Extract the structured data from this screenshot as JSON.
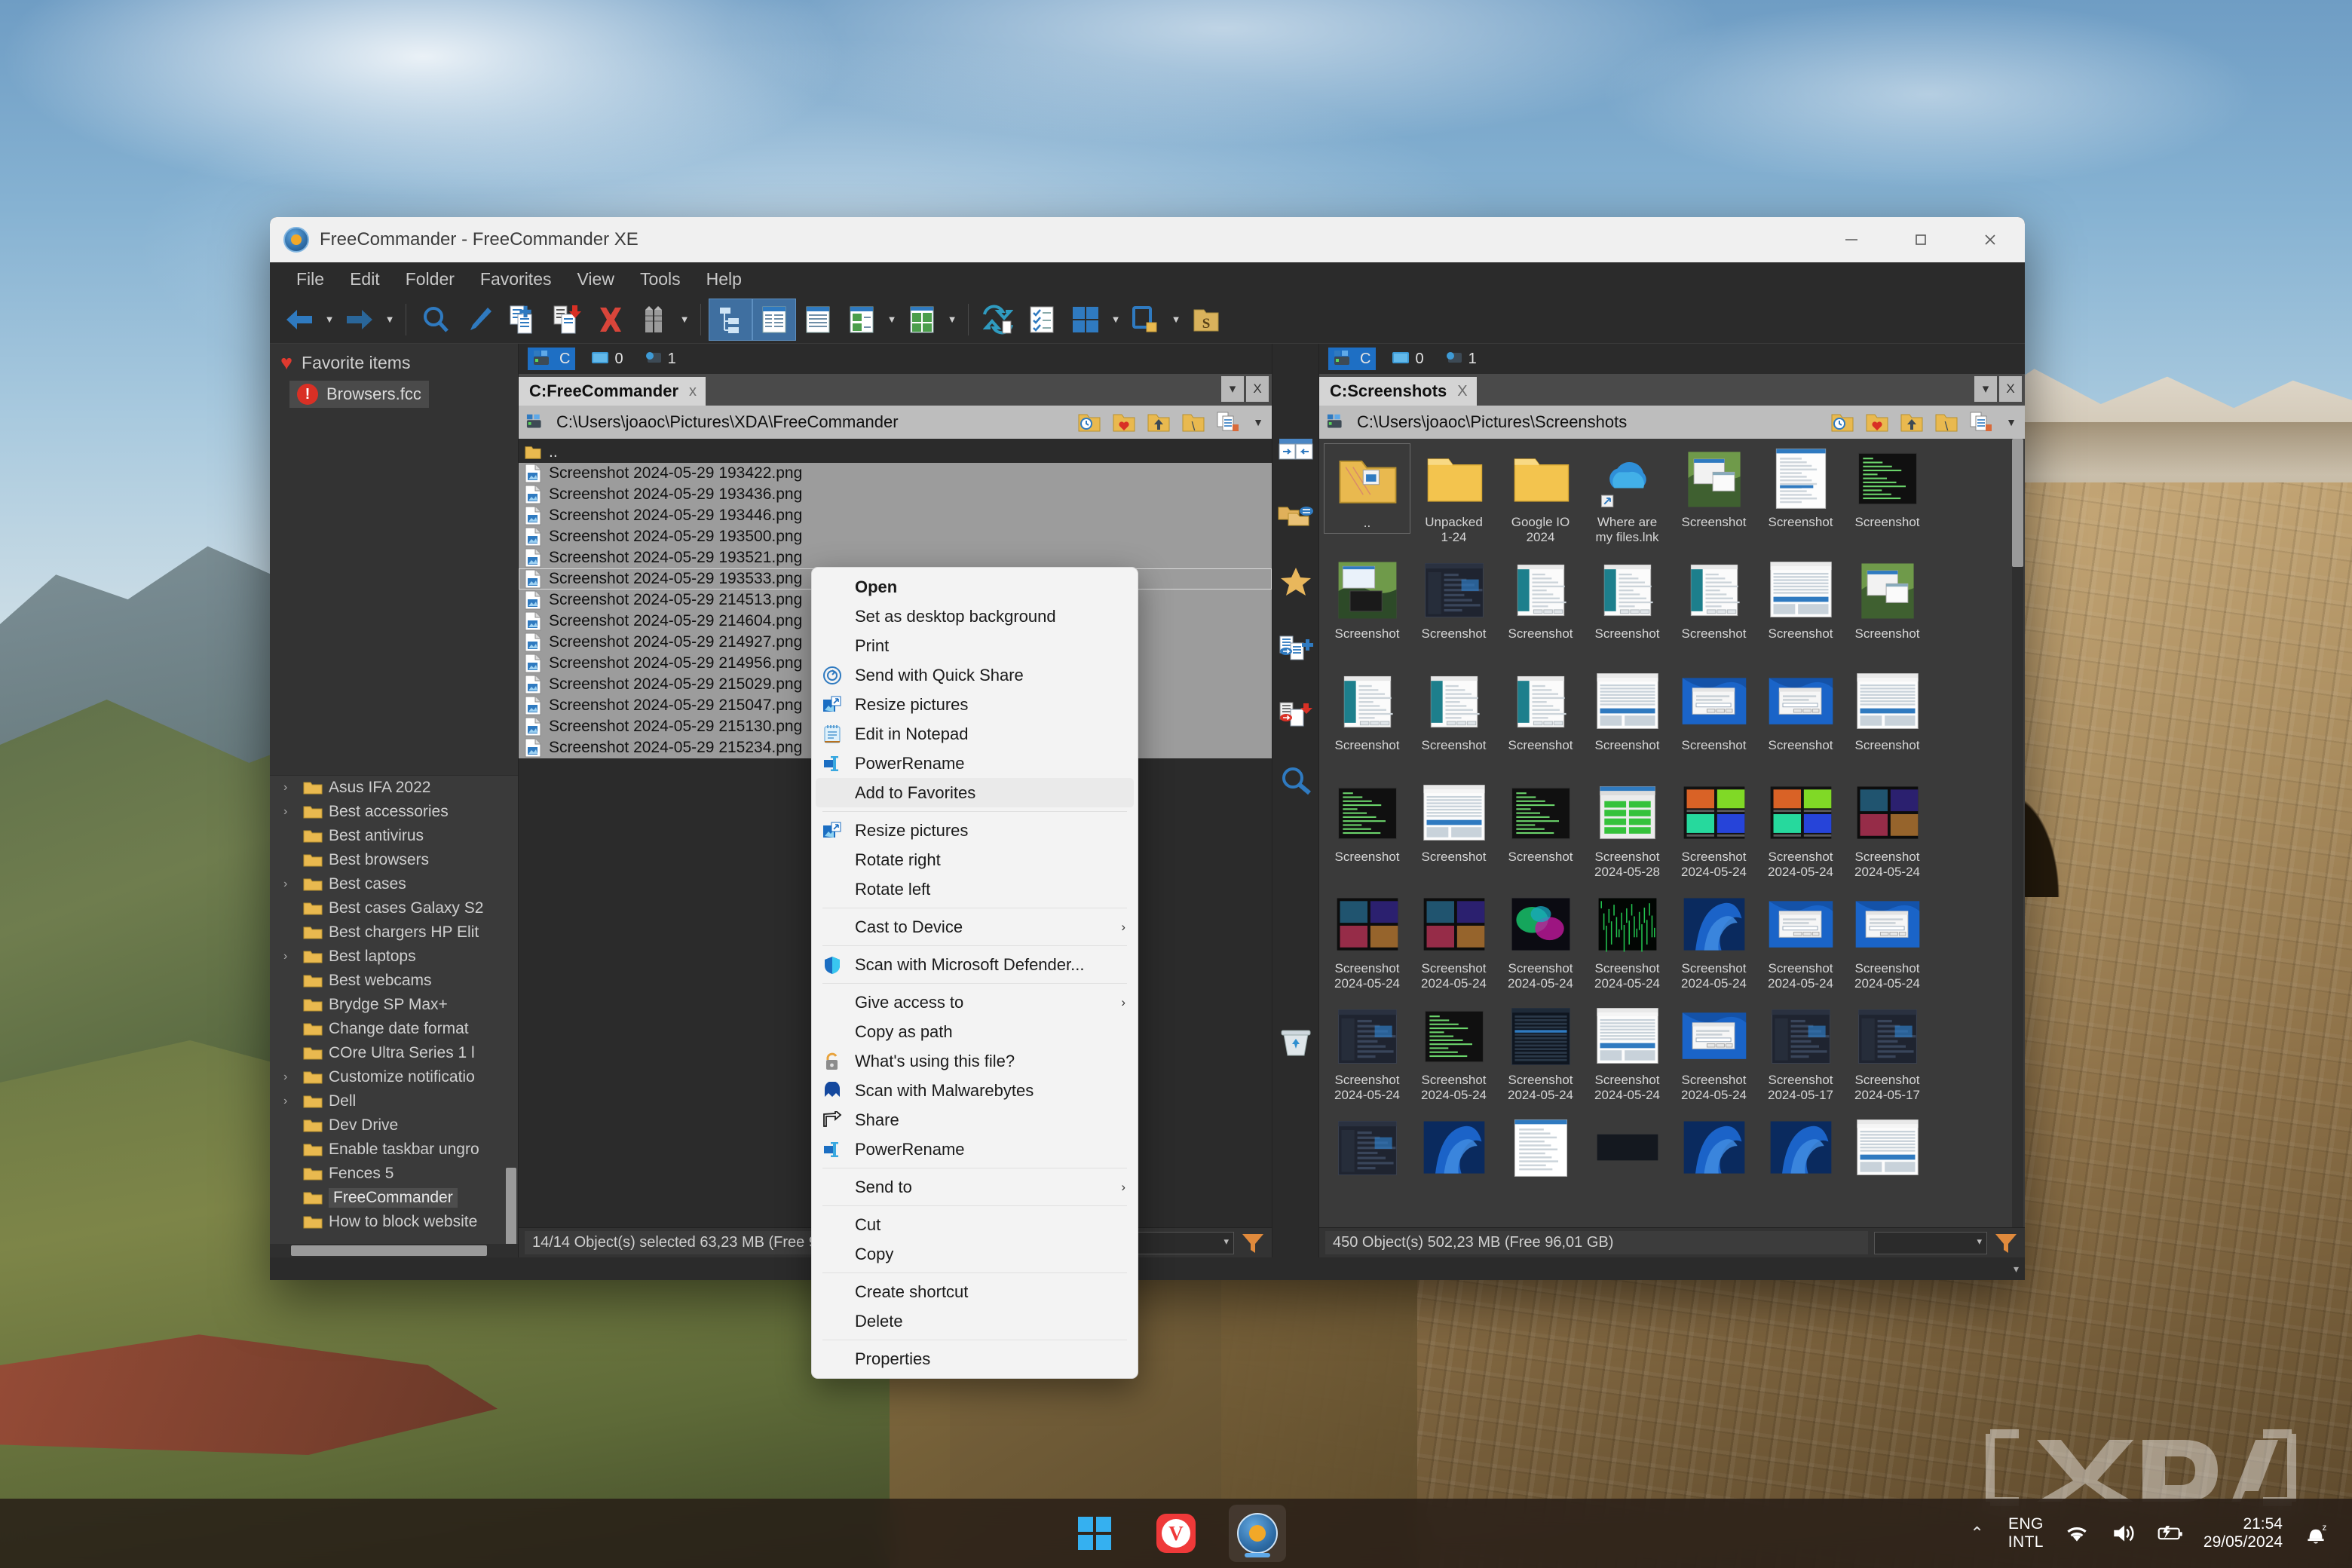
{
  "window": {
    "title": "FreeCommander - FreeCommander XE",
    "app_icon": "freecommander-compass-icon",
    "controls": {
      "minimize": "minimize-icon",
      "maximize": "maximize-icon",
      "close": "close-icon"
    }
  },
  "menubar": [
    "File",
    "Edit",
    "Folder",
    "Favorites",
    "View",
    "Tools",
    "Help"
  ],
  "toolbar": {
    "groups": [
      [
        "back-arrow-icon",
        "back-dropdown-caret",
        "forward-arrow-icon",
        "forward-dropdown-caret"
      ],
      [
        "search-icon",
        "edit-pencil-icon",
        "copy-file-icon",
        "move-file-icon",
        "delete-x-icon",
        "pack-icon",
        "pack-dropdown-caret"
      ],
      [
        "tree-view-icon",
        "details-view-icon",
        "list-view-icon",
        "thumbnail-view-icon",
        "thumbnail-dropdown-caret",
        "large-thumbnail-view-icon",
        "large-thumbnail-dropdown-caret"
      ],
      [
        "sync-folders-icon",
        "checklist-icon",
        "split-view-icon",
        "split-view-dropdown-caret",
        "screen-icon",
        "screen-dropdown-caret",
        "folder-s-icon"
      ]
    ]
  },
  "favorites_pane": {
    "header_label": "Favorite items",
    "header_icon": "heart-icon",
    "items": [
      {
        "label": "Browsers.fcc",
        "icon": "warning-circle-icon",
        "selected": true
      }
    ]
  },
  "folder_tree": {
    "items": [
      {
        "label": "Asus IFA 2022",
        "expandable": true,
        "selected": false
      },
      {
        "label": "Best accessories",
        "expandable": true,
        "selected": false
      },
      {
        "label": "Best antivirus",
        "expandable": false,
        "selected": false
      },
      {
        "label": "Best browsers",
        "expandable": false,
        "selected": false
      },
      {
        "label": "Best cases",
        "expandable": true,
        "selected": false
      },
      {
        "label": "Best cases Galaxy S2",
        "expandable": false,
        "selected": false
      },
      {
        "label": "Best chargers HP Elit",
        "expandable": false,
        "selected": false
      },
      {
        "label": "Best laptops",
        "expandable": true,
        "selected": false
      },
      {
        "label": "Best webcams",
        "expandable": false,
        "selected": false
      },
      {
        "label": "Brydge SP Max+",
        "expandable": false,
        "selected": false
      },
      {
        "label": "Change date format",
        "expandable": false,
        "selected": false
      },
      {
        "label": "COre Ultra Series 1 l",
        "expandable": false,
        "selected": false
      },
      {
        "label": "Customize notificatio",
        "expandable": true,
        "selected": false
      },
      {
        "label": "Dell",
        "expandable": true,
        "selected": false
      },
      {
        "label": "Dev Drive",
        "expandable": false,
        "selected": false
      },
      {
        "label": "Enable taskbar ungro",
        "expandable": false,
        "selected": false
      },
      {
        "label": "Fences 5",
        "expandable": false,
        "selected": false
      },
      {
        "label": "FreeCommander",
        "expandable": false,
        "selected": true
      },
      {
        "label": "How to block website",
        "expandable": false,
        "selected": false
      }
    ]
  },
  "left_panel": {
    "drives": [
      {
        "label": "C",
        "icon": "drive-c-icon",
        "active": true
      },
      {
        "label": "0",
        "icon": "network-drive-icon",
        "active": false
      },
      {
        "label": "1",
        "icon": "remote-drive-icon",
        "active": false
      }
    ],
    "tab": {
      "label": "C:FreeCommander",
      "close": "x"
    },
    "tab_controls": {
      "dropdown": "▾",
      "close": "X"
    },
    "path": "C:\\Users\\joaoc\\Pictures\\XDA\\FreeCommander",
    "path_icons": [
      "history-folder-icon",
      "favorite-folder-icon",
      "parent-folder-icon",
      "root-folder-icon",
      "copy-path-icon",
      "path-dropdown-caret"
    ],
    "updir_label": "..",
    "files": [
      {
        "name": "Screenshot 2024-05-29 193422.png",
        "selected": true,
        "cursor": false
      },
      {
        "name": "Screenshot 2024-05-29 193436.png",
        "selected": true,
        "cursor": false
      },
      {
        "name": "Screenshot 2024-05-29 193446.png",
        "selected": true,
        "cursor": false
      },
      {
        "name": "Screenshot 2024-05-29 193500.png",
        "selected": true,
        "cursor": false
      },
      {
        "name": "Screenshot 2024-05-29 193521.png",
        "selected": true,
        "cursor": false
      },
      {
        "name": "Screenshot 2024-05-29 193533.png",
        "selected": true,
        "cursor": true
      },
      {
        "name": "Screenshot 2024-05-29 214513.png",
        "selected": true,
        "cursor": false
      },
      {
        "name": "Screenshot 2024-05-29 214604.png",
        "selected": true,
        "cursor": false
      },
      {
        "name": "Screenshot 2024-05-29 214927.png",
        "selected": true,
        "cursor": false
      },
      {
        "name": "Screenshot 2024-05-29 214956.png",
        "selected": true,
        "cursor": false
      },
      {
        "name": "Screenshot 2024-05-29 215029.png",
        "selected": true,
        "cursor": false
      },
      {
        "name": "Screenshot 2024-05-29 215047.png",
        "selected": true,
        "cursor": false
      },
      {
        "name": "Screenshot 2024-05-29 215130.png",
        "selected": true,
        "cursor": false
      },
      {
        "name": "Screenshot 2024-05-29 215234.png",
        "selected": true,
        "cursor": false
      }
    ],
    "status": "14/14 Object(s) selected  63,23 MB  (Free 96,01 GB)"
  },
  "mid_toolbar": [
    "swap-panels-icon",
    "compare-folders-icon",
    "favorites-star-icon",
    "copy-to-icon",
    "move-to-icon",
    "search-icon",
    "recycle-bin-icon"
  ],
  "right_panel": {
    "drives": [
      {
        "label": "C",
        "icon": "drive-c-icon",
        "active": true
      },
      {
        "label": "0",
        "icon": "network-drive-icon",
        "active": false
      },
      {
        "label": "1",
        "icon": "remote-drive-icon",
        "active": false
      }
    ],
    "tab": {
      "label": "C:Screenshots",
      "close": "X"
    },
    "tab_controls": {
      "dropdown": "▾",
      "close": "X"
    },
    "path": "C:\\Users\\joaoc\\Pictures\\Screenshots",
    "path_icons": [
      "history-folder-icon",
      "favorite-folder-icon",
      "parent-folder-icon",
      "root-folder-icon",
      "copy-path-icon",
      "path-dropdown-caret"
    ],
    "items": [
      {
        "line1": "..",
        "line2": "",
        "kind": "updir"
      },
      {
        "line1": "Unpacked",
        "line2": "1-24",
        "kind": "folder"
      },
      {
        "line1": "Google IO",
        "line2": "2024",
        "kind": "folder"
      },
      {
        "line1": "Where are",
        "line2": "my files.lnk",
        "kind": "onedrive-shortcut"
      },
      {
        "line1": "Screenshot",
        "line2": "",
        "kind": "image-landscape-dialog"
      },
      {
        "line1": "Screenshot",
        "line2": "",
        "kind": "image-settings-list"
      },
      {
        "line1": "Screenshot",
        "line2": "",
        "kind": "image-terminal"
      },
      {
        "line1": "Screenshot",
        "line2": "",
        "kind": "image-landscape-dark"
      },
      {
        "line1": "Screenshot",
        "line2": "",
        "kind": "image-darkapp"
      },
      {
        "line1": "Screenshot",
        "line2": "",
        "kind": "image-wizard"
      },
      {
        "line1": "Screenshot",
        "line2": "",
        "kind": "image-wizard"
      },
      {
        "line1": "Screenshot",
        "line2": "",
        "kind": "image-wizard"
      },
      {
        "line1": "Screenshot",
        "line2": "",
        "kind": "image-diskmgmt"
      },
      {
        "line1": "Screenshot",
        "line2": "",
        "kind": "image-landscape-dialog"
      },
      {
        "line1": "Screenshot",
        "line2": "",
        "kind": "image-wizard"
      },
      {
        "line1": "Screenshot",
        "line2": "",
        "kind": "image-wizard"
      },
      {
        "line1": "Screenshot",
        "line2": "",
        "kind": "image-wizard"
      },
      {
        "line1": "Screenshot",
        "line2": "",
        "kind": "image-diskmgmt"
      },
      {
        "line1": "Screenshot",
        "line2": "",
        "kind": "image-dialog-warn"
      },
      {
        "line1": "Screenshot",
        "line2": "",
        "kind": "image-field"
      },
      {
        "line1": "Screenshot",
        "line2": "",
        "kind": "image-diskmgmt"
      },
      {
        "line1": "Screenshot",
        "line2": "",
        "kind": "image-terminal"
      },
      {
        "line1": "Screenshot",
        "line2": "",
        "kind": "image-diskmgmt"
      },
      {
        "line1": "Screenshot",
        "line2": "",
        "kind": "image-terminal"
      },
      {
        "line1": "Screenshot",
        "line2": "2024-05-28",
        "kind": "image-crystaldisk"
      },
      {
        "line1": "Screenshot",
        "line2": "2024-05-24",
        "kind": "image-colorgrid"
      },
      {
        "line1": "Screenshot",
        "line2": "2024-05-24",
        "kind": "image-colorgrid2"
      },
      {
        "line1": "Screenshot",
        "line2": "2024-05-24",
        "kind": "image-artgrid"
      },
      {
        "line1": "Screenshot",
        "line2": "2024-05-24",
        "kind": "image-artgrid2"
      },
      {
        "line1": "Screenshot",
        "line2": "2024-05-24",
        "kind": "image-artgrid3"
      },
      {
        "line1": "Screenshot",
        "line2": "2024-05-24",
        "kind": "image-abstract"
      },
      {
        "line1": "Screenshot",
        "line2": "2024-05-24",
        "kind": "image-matrix"
      },
      {
        "line1": "Screenshot",
        "line2": "2024-05-24",
        "kind": "image-win11bloom"
      },
      {
        "line1": "Screenshot",
        "line2": "2024-05-24",
        "kind": "image-win-dialog"
      },
      {
        "line1": "Screenshot",
        "line2": "2024-05-24",
        "kind": "image-win-dialog2"
      },
      {
        "line1": "Screenshot",
        "line2": "2024-05-24",
        "kind": "image-darkui"
      },
      {
        "line1": "Screenshot",
        "line2": "2024-05-24",
        "kind": "image-terminal-dark"
      },
      {
        "line1": "Screenshot",
        "line2": "2024-05-24",
        "kind": "image-tasklist"
      },
      {
        "line1": "Screenshot",
        "line2": "2024-05-24",
        "kind": "image-explorer"
      },
      {
        "line1": "Screenshot",
        "line2": "2024-05-24",
        "kind": "image-win-dialog3"
      },
      {
        "line1": "Screenshot",
        "line2": "2024-05-17",
        "kind": "image-darkui2"
      },
      {
        "line1": "Screenshot",
        "line2": "2024-05-17",
        "kind": "image-darkui3"
      },
      {
        "line1": "",
        "line2": "",
        "kind": "image-darkui4"
      },
      {
        "line1": "",
        "line2": "",
        "kind": "image-win11bloom"
      },
      {
        "line1": "",
        "line2": "",
        "kind": "image-doc"
      },
      {
        "line1": "",
        "line2": "",
        "kind": "image-dark-strip"
      },
      {
        "line1": "",
        "line2": "",
        "kind": "image-win11bloom"
      },
      {
        "line1": "",
        "line2": "",
        "kind": "image-win11bloom"
      },
      {
        "line1": "",
        "line2": "",
        "kind": "image-explorer2"
      }
    ],
    "status": "450 Object(s)  502,23 MB  (Free 96,01 GB)"
  },
  "context_menu": {
    "items": [
      {
        "label": "Open",
        "icon": null,
        "bold": true,
        "submenu": false,
        "highlight": false,
        "separator_after": false
      },
      {
        "label": "Set as desktop background",
        "icon": null,
        "bold": false,
        "submenu": false,
        "highlight": false,
        "separator_after": false
      },
      {
        "label": "Print",
        "icon": null,
        "bold": false,
        "submenu": false,
        "highlight": false,
        "separator_after": false
      },
      {
        "label": "Send with Quick Share",
        "icon": "quick-share-icon",
        "bold": false,
        "submenu": false,
        "highlight": false,
        "separator_after": false
      },
      {
        "label": "Resize pictures",
        "icon": "resize-pictures-icon",
        "bold": false,
        "submenu": false,
        "highlight": false,
        "separator_after": false
      },
      {
        "label": "Edit in Notepad",
        "icon": "notepad-icon",
        "bold": false,
        "submenu": false,
        "highlight": false,
        "separator_after": false
      },
      {
        "label": "PowerRename",
        "icon": "powerrename-icon",
        "bold": false,
        "submenu": false,
        "highlight": false,
        "separator_after": false
      },
      {
        "label": "Add to Favorites",
        "icon": null,
        "bold": false,
        "submenu": false,
        "highlight": true,
        "separator_after": true
      },
      {
        "label": "Resize pictures",
        "icon": "resize-pictures-icon",
        "bold": false,
        "submenu": false,
        "highlight": false,
        "separator_after": false
      },
      {
        "label": "Rotate right",
        "icon": null,
        "bold": false,
        "submenu": false,
        "highlight": false,
        "separator_after": false
      },
      {
        "label": "Rotate left",
        "icon": null,
        "bold": false,
        "submenu": false,
        "highlight": false,
        "separator_after": true
      },
      {
        "label": "Cast to Device",
        "icon": null,
        "bold": false,
        "submenu": true,
        "highlight": false,
        "separator_after": true
      },
      {
        "label": "Scan with Microsoft Defender...",
        "icon": "defender-shield-icon",
        "bold": false,
        "submenu": false,
        "highlight": false,
        "separator_after": true
      },
      {
        "label": "Give access to",
        "icon": null,
        "bold": false,
        "submenu": true,
        "highlight": false,
        "separator_after": false
      },
      {
        "label": "Copy as path",
        "icon": null,
        "bold": false,
        "submenu": false,
        "highlight": false,
        "separator_after": false
      },
      {
        "label": "What's using this file?",
        "icon": "lock-icon",
        "bold": false,
        "submenu": false,
        "highlight": false,
        "separator_after": false
      },
      {
        "label": "Scan with Malwarebytes",
        "icon": "malwarebytes-icon",
        "bold": false,
        "submenu": false,
        "highlight": false,
        "separator_after": false
      },
      {
        "label": "Share",
        "icon": "share-icon",
        "bold": false,
        "submenu": false,
        "highlight": false,
        "separator_after": false
      },
      {
        "label": "PowerRename",
        "icon": "powerrename-icon",
        "bold": false,
        "submenu": false,
        "highlight": false,
        "separator_after": true
      },
      {
        "label": "Send to",
        "icon": null,
        "bold": false,
        "submenu": true,
        "highlight": false,
        "separator_after": true
      },
      {
        "label": "Cut",
        "icon": null,
        "bold": false,
        "submenu": false,
        "highlight": false,
        "separator_after": false
      },
      {
        "label": "Copy",
        "icon": null,
        "bold": false,
        "submenu": false,
        "highlight": false,
        "separator_after": true
      },
      {
        "label": "Create shortcut",
        "icon": null,
        "bold": false,
        "submenu": false,
        "highlight": false,
        "separator_after": false
      },
      {
        "label": "Delete",
        "icon": null,
        "bold": false,
        "submenu": false,
        "highlight": false,
        "separator_after": true
      },
      {
        "label": "Properties",
        "icon": null,
        "bold": false,
        "submenu": false,
        "highlight": false,
        "separator_after": false
      }
    ]
  },
  "taskbar": {
    "buttons": [
      {
        "name": "start-button",
        "icon": "windows-logo-icon",
        "active": false
      },
      {
        "name": "vivaldi-button",
        "icon": "vivaldi-icon",
        "active": false
      },
      {
        "name": "freecommander-button",
        "icon": "freecommander-compass-icon",
        "active": true
      }
    ],
    "tray": {
      "chevron": "⌃",
      "language": {
        "line1": "ENG",
        "line2": "INTL"
      },
      "icons": [
        "wifi-icon",
        "volume-icon",
        "battery-charging-icon"
      ],
      "clock": {
        "time": "21:54",
        "date": "29/05/2024"
      },
      "notification_icon": "bell-dnd-icon"
    }
  },
  "colors": {
    "accent": "#1e6fc4",
    "window_bg": "#2b2b2b",
    "panel_bg": "#3a3a3a",
    "selection": "#9c9c9c",
    "menu_bg": "#f3f3f3"
  }
}
